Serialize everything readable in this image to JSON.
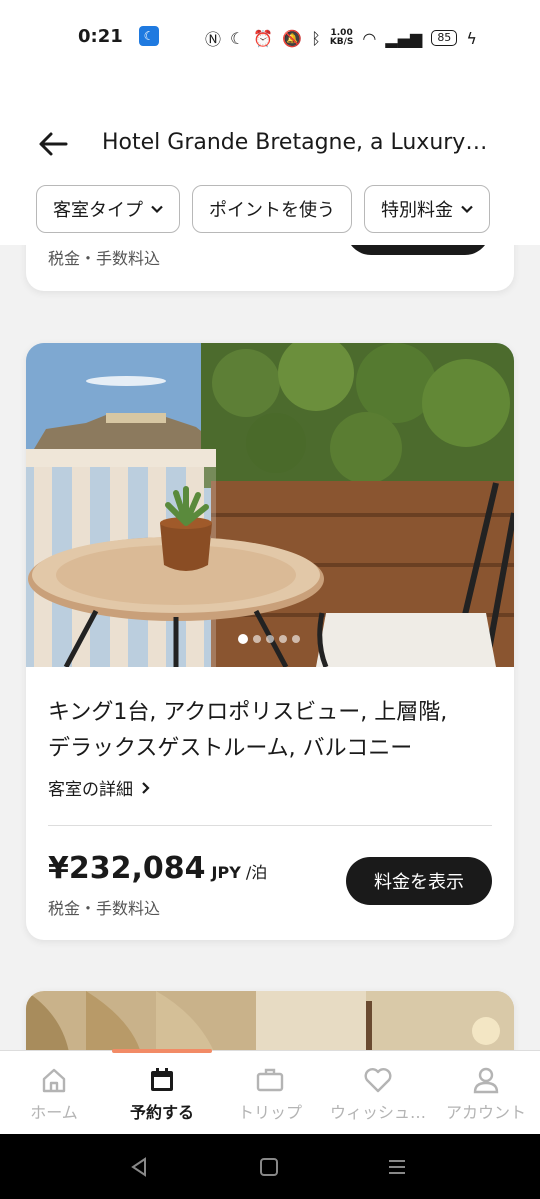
{
  "status_bar": {
    "time": "0:21",
    "net_speed_value": "1.00",
    "net_speed_unit": "KB/S",
    "battery": "85"
  },
  "header": {
    "title": "Hotel Grande Bretagne, a Luxury…",
    "filters": [
      "客室タイプ",
      "ポイントを使う",
      "特別料金"
    ]
  },
  "previous_card": {
    "tax_note": "税金・手数料込"
  },
  "room_card": {
    "name_line1": "キング1台, アクロポリスビュー, 上層階,",
    "name_line2": "デラックスゲストルーム, バルコニー",
    "details_link": "客室の詳細",
    "price": "¥232,084",
    "currency": "JPY",
    "per_night": "/泊",
    "tax_note": "税金・手数料込",
    "show_rate_button": "料金を表示",
    "photo_count": 5,
    "photo_index": 1
  },
  "bottom_nav": [
    {
      "label": "ホーム",
      "icon": "home-icon"
    },
    {
      "label": "予約する",
      "icon": "calendar-icon",
      "active": true
    },
    {
      "label": "トリップ",
      "icon": "briefcase-icon"
    },
    {
      "label": "ウィッシュ…",
      "icon": "heart-icon"
    },
    {
      "label": "アカウント",
      "icon": "person-icon"
    }
  ],
  "colors": {
    "accent": "#f28b66",
    "button": "#1a1a1a"
  }
}
